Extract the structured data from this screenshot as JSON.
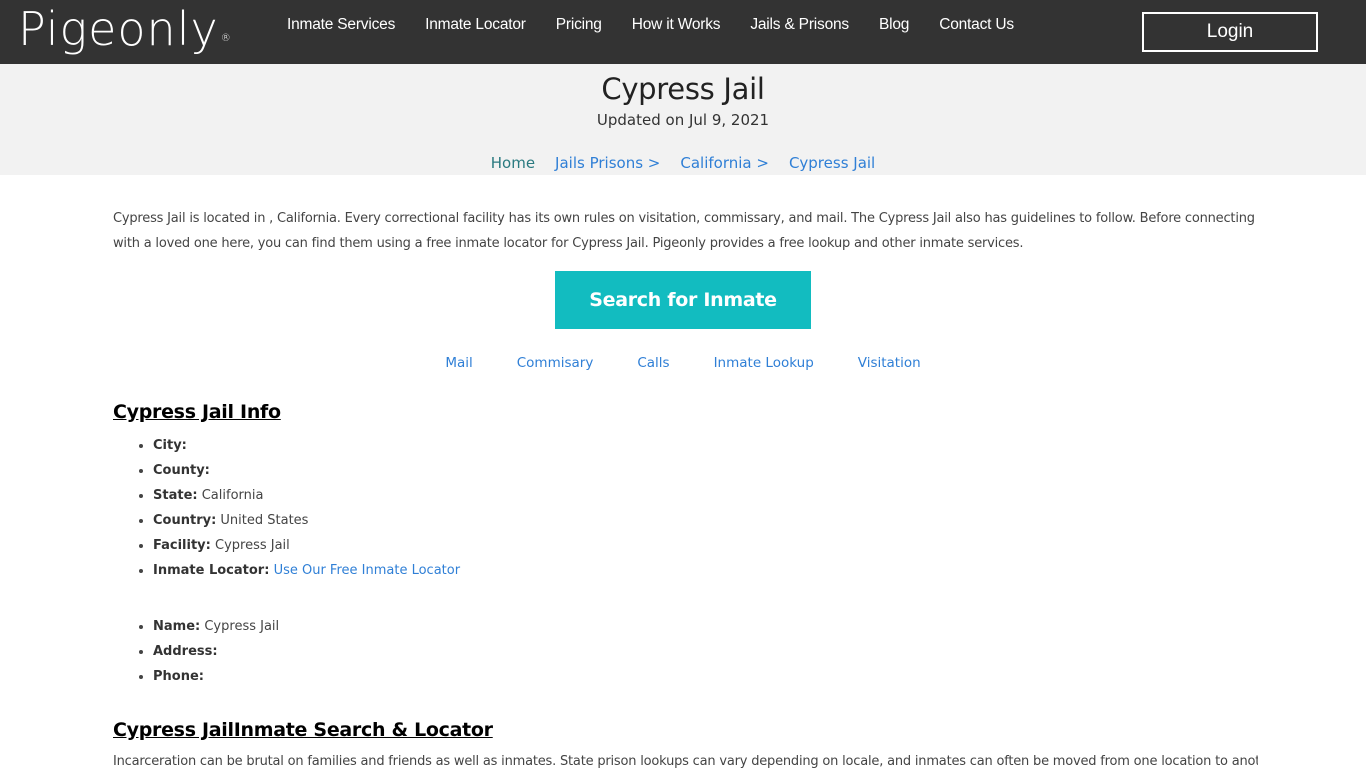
{
  "header": {
    "logo": "Pigeonly",
    "logo_mark": "®",
    "nav": [
      "Inmate Services",
      "Inmate Locator",
      "Pricing",
      "How it Works",
      "Jails & Prisons",
      "Blog",
      "Contact Us"
    ],
    "login_label": "Login"
  },
  "hero": {
    "title": "Cypress Jail",
    "updated": "Updated on Jul 9, 2021",
    "breadcrumb": [
      "Home",
      "Jails Prisons >",
      "California >",
      "Cypress Jail"
    ]
  },
  "intro": "Cypress Jail is located in , California. Every correctional facility has its own rules on visitation, commissary, and mail. The Cypress Jail also has guidelines to follow. Before connecting with a loved one here, you can find them using a free inmate locator for Cypress Jail. Pigeonly provides a free lookup and other inmate services.",
  "search_button": "Search for Inmate",
  "service_links": [
    "Mail",
    "Commisary",
    "Calls",
    "Inmate Lookup",
    "Visitation"
  ],
  "info": {
    "title": "Cypress Jail Info",
    "items": [
      {
        "label": "City:",
        "value": ""
      },
      {
        "label": "County:",
        "value": ""
      },
      {
        "label": "State:",
        "value": "California"
      },
      {
        "label": "Country:",
        "value": "United States"
      },
      {
        "label": "Facility:",
        "value": "Cypress Jail"
      },
      {
        "label": "Inmate Locator:",
        "link": "Use Our Free Inmate Locator"
      }
    ],
    "contact": [
      {
        "label": "Name:",
        "value": "Cypress Jail"
      },
      {
        "label": "Address:",
        "value": ""
      },
      {
        "label": "Phone:",
        "value": ""
      }
    ]
  },
  "locator": {
    "title": "Cypress JailInmate Search & Locator",
    "text": "Incarceration can be brutal on families and friends as well as inmates. State prison lookups can vary depending on locale, and inmates can often be moved from one location to another"
  },
  "colors": {
    "topbar": "#333333",
    "hero_bg": "#f2f2f2",
    "accent": "#12bcc0",
    "link": "#2f7fd6"
  }
}
